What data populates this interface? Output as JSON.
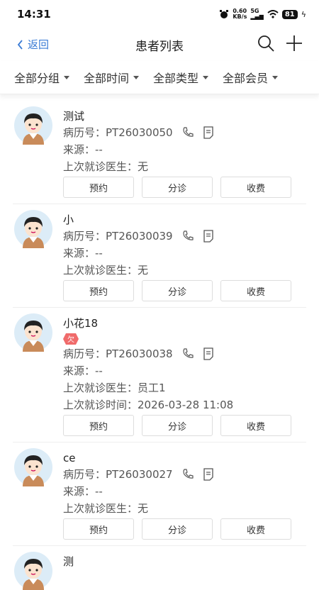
{
  "status": {
    "time": "14:31",
    "net_speed": "0.60",
    "net_unit": "KB/s",
    "signal": "5G",
    "battery": "81"
  },
  "nav": {
    "back": "返回",
    "title": "患者列表"
  },
  "filters": [
    "全部分组",
    "全部时间",
    "全部类型",
    "全部会员"
  ],
  "labels": {
    "record": "病历号：",
    "source": "来源：",
    "last_doctor": "上次就诊医生：",
    "last_time": "上次就诊时间："
  },
  "actions": {
    "book": "预约",
    "triage": "分诊",
    "charge": "收费"
  },
  "owe_badge": "欠",
  "patients": [
    {
      "name": "测试",
      "record": "PT26030050",
      "source": "--",
      "last_doctor": "无"
    },
    {
      "name": "小",
      "record": "PT26030039",
      "source": "--",
      "last_doctor": "无"
    },
    {
      "name": "小花18",
      "record": "PT26030038",
      "source": "--",
      "last_doctor": "员工1",
      "last_time": "2026-03-28 11:08"
    },
    {
      "name": "ce",
      "record": "PT26030027",
      "source": "--",
      "last_doctor": "无"
    },
    {
      "name": "测"
    }
  ]
}
